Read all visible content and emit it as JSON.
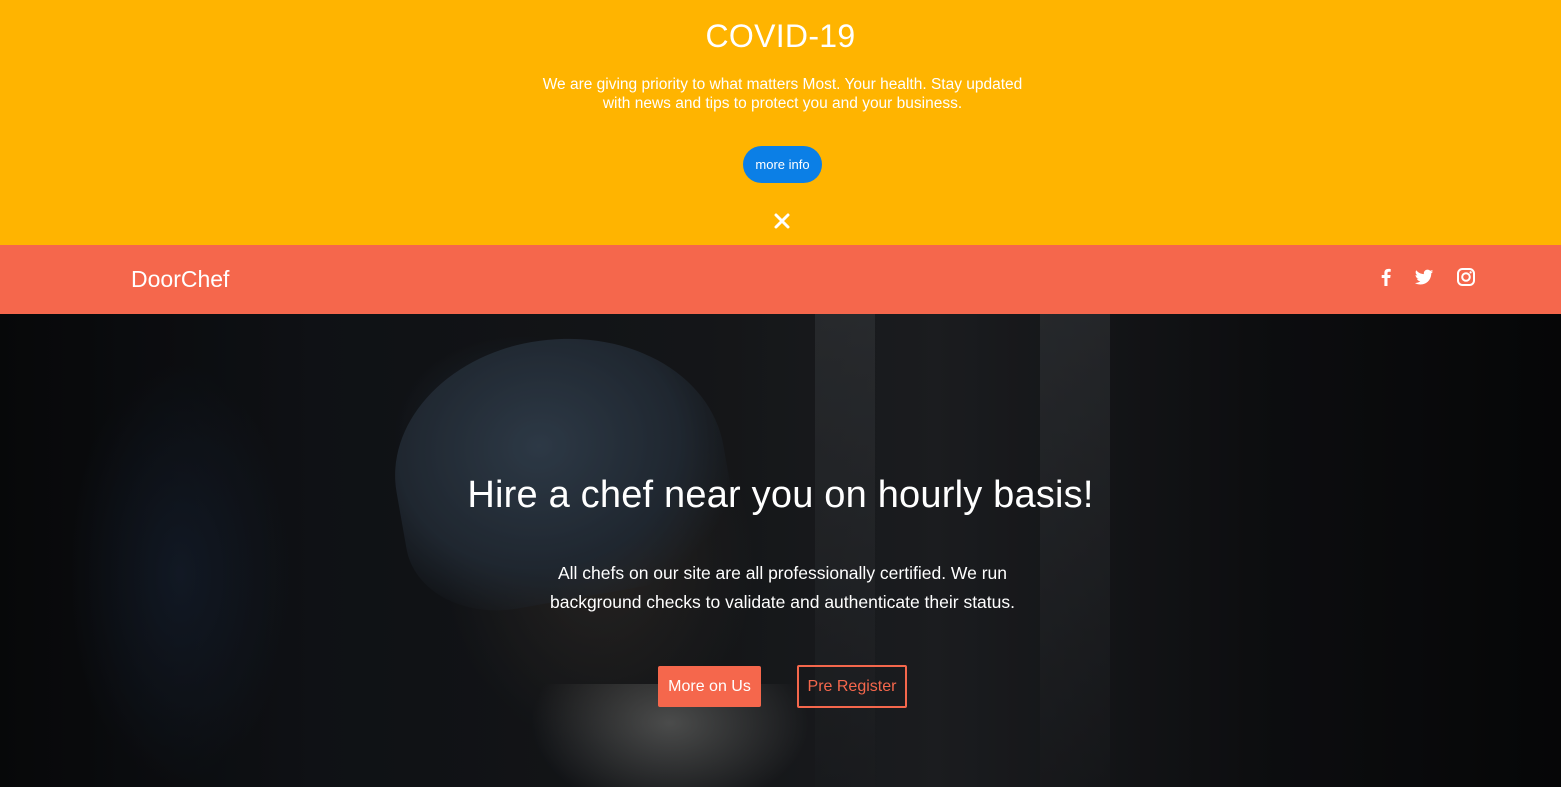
{
  "covid_banner": {
    "title": "COVID-19",
    "message": "We are giving priority to what matters Most. Your health. Stay updated with news and tips to protect you and your business.",
    "more_info_label": "more info",
    "close_icon": "close-icon",
    "background_color": "#ffb400",
    "button_color": "#0b7fe6"
  },
  "navbar": {
    "brand": "DoorChef",
    "background_color": "#f5674c",
    "social_icons": [
      "facebook-icon",
      "twitter-icon",
      "instagram-icon"
    ]
  },
  "hero": {
    "title": "Hire a chef near you on hourly basis!",
    "description": "All chefs on our site are all professionally certified. We run background checks to validate and authenticate their status.",
    "primary_button_label": "More on Us",
    "secondary_button_label": "Pre Register",
    "accent_color": "#f5674c"
  }
}
